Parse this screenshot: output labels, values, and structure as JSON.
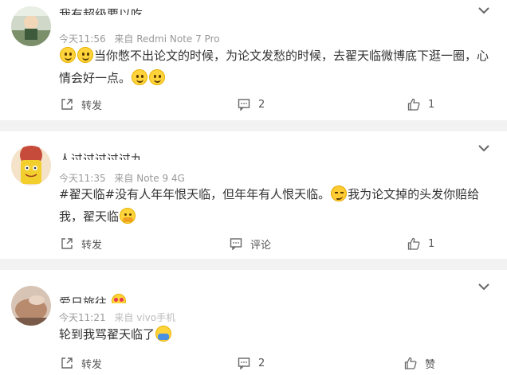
{
  "comments": [
    {
      "username": "我有超级要以吃",
      "time": "今天11:56",
      "source": "来自 Redmi Note 7 Pro",
      "text_before": "",
      "text_main": "当你憋不出论文的时候，为论文发愁的时候，去翟天临微博底下逛一圈，心情会好一点。",
      "emoji_lead": [
        "smile-emoji",
        "smile-emoji"
      ],
      "emoji_trail": [
        "smile-emoji",
        "smile-emoji"
      ],
      "actions": {
        "forward": "转发",
        "comment": "2",
        "like": "1"
      }
    },
    {
      "username": "人过过过过过九",
      "time": "今天11:35",
      "source": "来自 Note 9 4G",
      "text_part1": "#翟天临#没有人年年恨天临，但年年有人恨天临。",
      "text_part2": "我为论文掉的头发你赔给我，翟天临",
      "emoji_mid": "smug-emoji",
      "emoji_end": "hug-emoji",
      "actions": {
        "forward": "转发",
        "comment": "评论",
        "like": "1"
      }
    },
    {
      "username": "爱日旅往",
      "time": "今天11:21",
      "source": "来自 vivo手机",
      "text": "轮到我骂翟天临了",
      "emoji_end": "cover-face-emoji",
      "actions": {
        "forward": "转发",
        "comment": "2",
        "like": "赞"
      }
    }
  ],
  "colors": {
    "background": "#f2f2f2",
    "card": "#ffffff",
    "text": "#333333",
    "meta": "#999999"
  }
}
